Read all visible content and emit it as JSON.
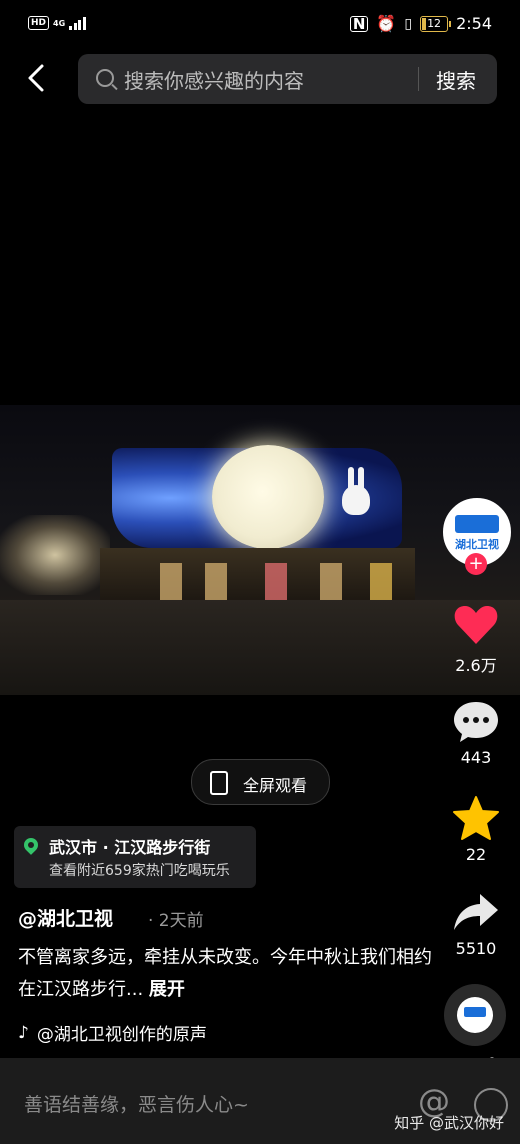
{
  "status_bar": {
    "left_label": "HD",
    "network": "4G",
    "battery": "12",
    "time": "2:54"
  },
  "header": {
    "search_placeholder": "搜索你感兴趣的内容",
    "search_button": "搜索"
  },
  "video": {
    "fullscreen_label": "全屏观看"
  },
  "location": {
    "title": "武汉市 · 江汉路步行街",
    "subtitle": "查看附近659家热门吃喝玩乐"
  },
  "post": {
    "author": "@湖北卫视",
    "time": "· 2天前",
    "description": "不管离家多远，牵挂从未改变。今年中秋让我们相约在江汉路步行...",
    "expand": "展开",
    "music": "@湖北卫视创作的原声"
  },
  "rail": {
    "avatar_text": "湖北卫视",
    "follow": "+",
    "likes": "2.6万",
    "comments": "443",
    "favorites": "22",
    "shares": "5510"
  },
  "bottom": {
    "comment_placeholder": "善语结善缘，恶言伤人心~",
    "at_symbol": "@",
    "watermark": "知乎 @武汉你好"
  },
  "colors": {
    "like": "#fe2c55",
    "favorite": "#ffc300",
    "location_pin": "#34c36a",
    "brand_blue": "#1a6ed8"
  }
}
